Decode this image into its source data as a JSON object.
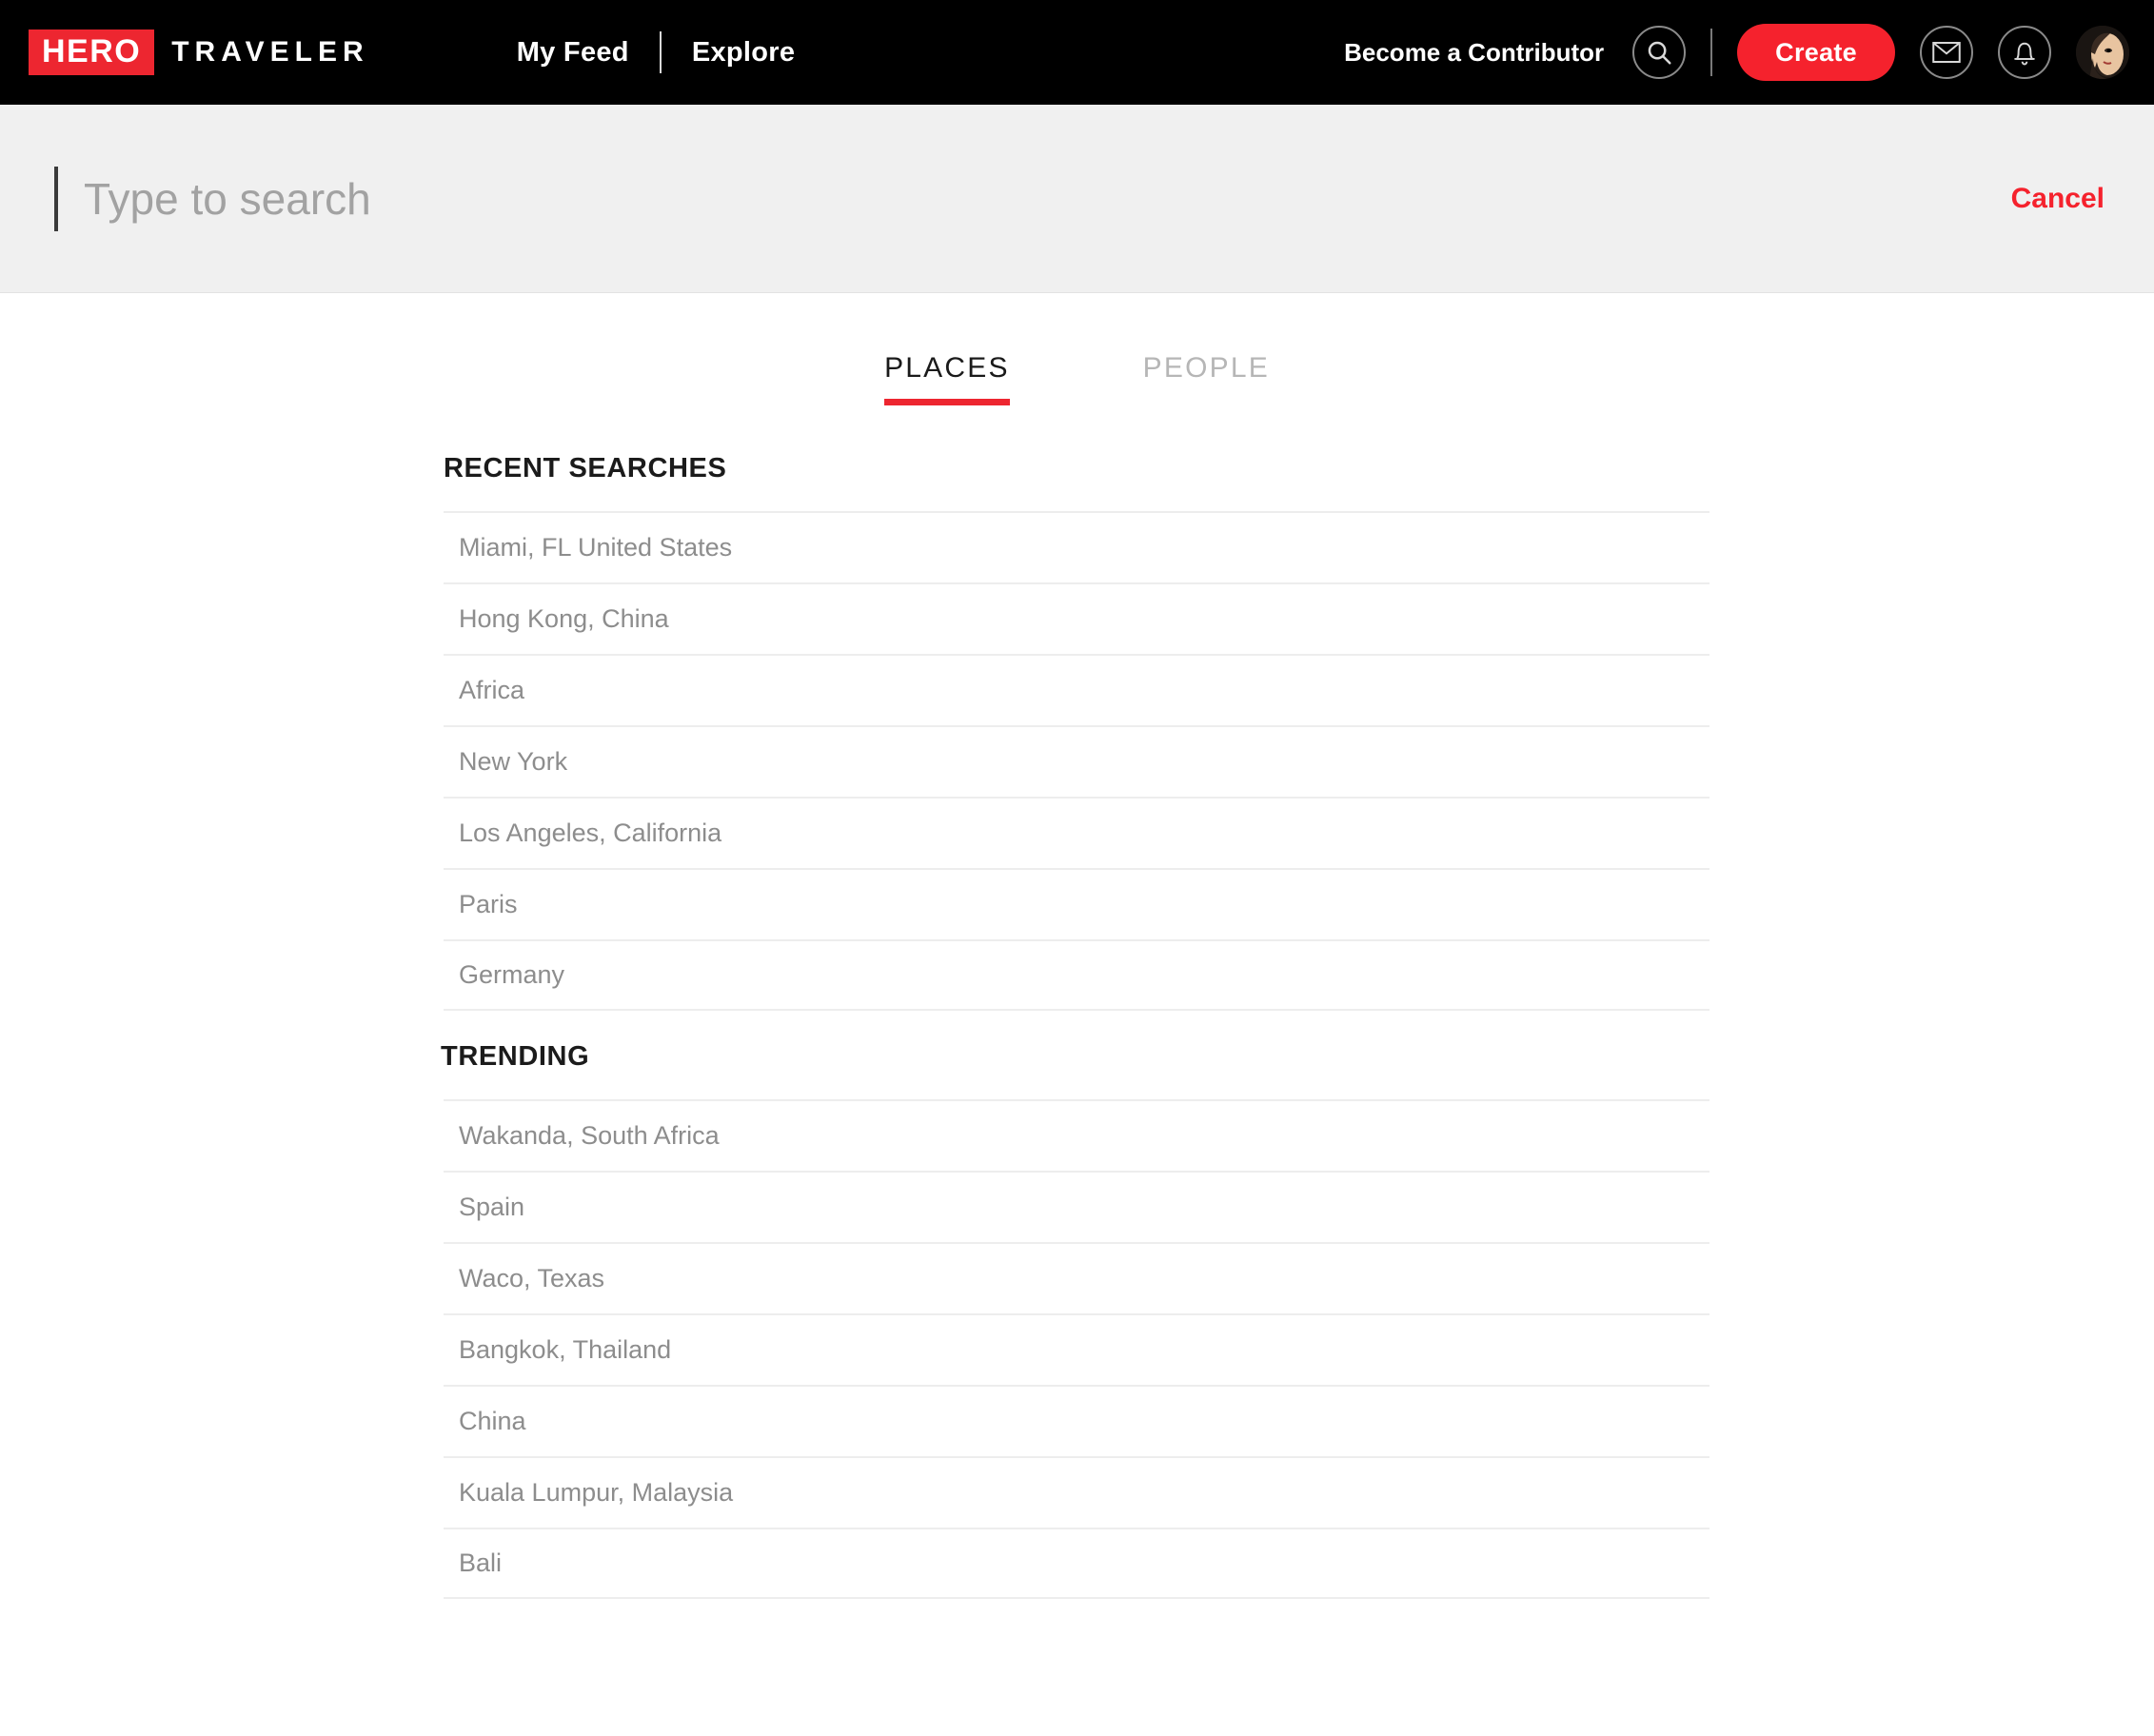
{
  "brand": {
    "badge": "HERO",
    "word": "TRAVELER"
  },
  "nav": {
    "links": [
      "My Feed",
      "Explore"
    ],
    "contributor_label": "Become a Contributor",
    "create_label": "Create",
    "icons": [
      "search-icon",
      "mail-icon",
      "bell-icon",
      "avatar"
    ]
  },
  "search": {
    "value": "",
    "placeholder": "Type to search",
    "cancel_label": "Cancel"
  },
  "tabs": [
    {
      "label": "PLACES",
      "active": true
    },
    {
      "label": "PEOPLE",
      "active": false
    }
  ],
  "sections": [
    {
      "title": "RECENT SEARCHES",
      "items": [
        "Miami, FL United States",
        "Hong Kong, China",
        "Africa",
        "New York",
        "Los Angeles, California",
        "Paris",
        "Germany"
      ]
    },
    {
      "title": "TRENDING",
      "items": [
        "Wakanda, South Africa",
        "Spain",
        "Waco, Texas",
        "Bangkok, Thailand",
        "China",
        "Kuala Lumpur, Malaysia",
        "Bali"
      ]
    }
  ],
  "colors": {
    "brand_red": "#ED2630",
    "accent_red": "#F5222D",
    "nav_bg": "#000000",
    "searchbar_bg": "#f0f0f0",
    "divider": "#ededed",
    "item_text": "#8d8d8d"
  }
}
